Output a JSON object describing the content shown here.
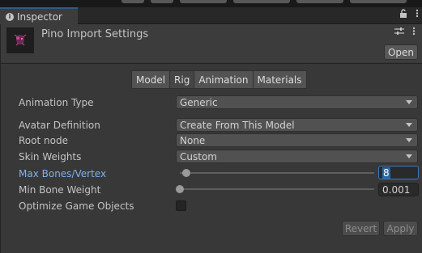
{
  "tab": {
    "label": "Inspector"
  },
  "header": {
    "title": "Pino Import Settings",
    "open_label": "Open"
  },
  "subtabs": [
    "Model",
    "Rig",
    "Animation",
    "Materials"
  ],
  "active_subtab": "Rig",
  "fields": {
    "animation_type": {
      "label": "Animation Type",
      "value": "Generic"
    },
    "avatar_definition": {
      "label": "Avatar Definition",
      "value": "Create From This Model"
    },
    "root_node": {
      "label": "Root node",
      "value": "None"
    },
    "skin_weights": {
      "label": "Skin Weights",
      "value": "Custom"
    },
    "max_bones": {
      "label": "Max Bones/Vertex",
      "value": "8",
      "slider_fraction": 0.03
    },
    "min_bone_weight": {
      "label": "Min Bone Weight",
      "value": "0.001",
      "slider_fraction": 0.0
    },
    "optimize": {
      "label": "Optimize Game Objects",
      "checked": false
    }
  },
  "buttons": {
    "revert": "Revert",
    "apply": "Apply"
  },
  "colors": {
    "accent_blue": "#3a79bb",
    "highlight_label": "#80b0e8",
    "background": "#383838"
  }
}
